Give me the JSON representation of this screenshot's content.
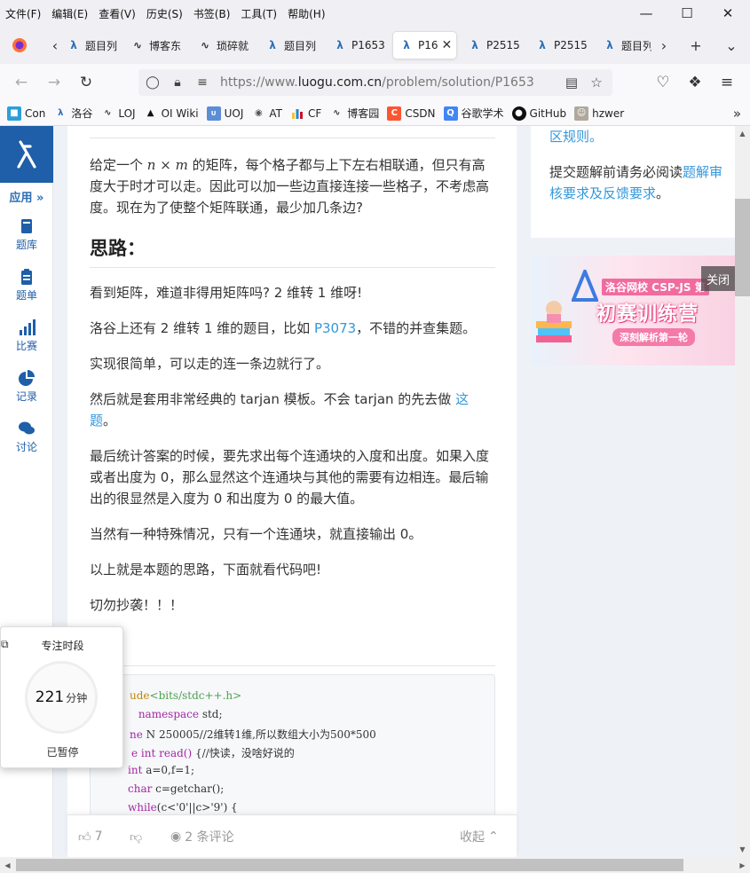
{
  "menu": [
    "文件(F)",
    "编辑(E)",
    "查看(V)",
    "历史(S)",
    "书签(B)",
    "工具(T)",
    "帮助(H)"
  ],
  "tabs": [
    {
      "label": "题目列",
      "icon": "luogu-icon"
    },
    {
      "label": "博客东",
      "icon": "cnblogs-icon"
    },
    {
      "label": "琐碎就",
      "icon": "cnblogs-icon"
    },
    {
      "label": "题目列",
      "icon": "luogu-icon"
    },
    {
      "label": "P1653",
      "icon": "luogu-icon"
    },
    {
      "label": "P16",
      "icon": "luogu-icon",
      "active": true
    },
    {
      "label": "P2515",
      "icon": "luogu-icon"
    },
    {
      "label": "P2515",
      "icon": "luogu-icon"
    },
    {
      "label": "题目列",
      "icon": "luogu-icon"
    }
  ],
  "url": {
    "prefix": "https://www.",
    "domain": "luogu.com.cn",
    "path": "/problem/solution/P1653"
  },
  "bookmarks": [
    {
      "label": "Con",
      "icon": "cube-icon",
      "color": "#2b6fb6"
    },
    {
      "label": "洛谷",
      "icon": "luogu-icon",
      "color": "#2b6fb6"
    },
    {
      "label": "LOJ",
      "icon": "loj-icon",
      "color": "#333333"
    },
    {
      "label": "OI Wiki",
      "icon": "graduation-cap-icon",
      "color": "#111111"
    },
    {
      "label": "UOJ",
      "icon": "uoj-icon",
      "color": "#e6a23c"
    },
    {
      "label": "AT",
      "icon": "atcoder-icon",
      "color": "#555555"
    },
    {
      "label": "CF",
      "icon": "codeforces-icon",
      "color": "#1f8acb"
    },
    {
      "label": "博客园",
      "icon": "cnblogs-icon",
      "color": "#333333"
    },
    {
      "label": "CSDN",
      "icon": "csdn-icon",
      "color": "#fc5531"
    },
    {
      "label": "谷歌学术",
      "icon": "scholar-icon",
      "color": "#4285f4"
    },
    {
      "label": "GitHub",
      "icon": "github-icon",
      "color": "#111111"
    },
    {
      "label": "hzwer",
      "icon": "avatar-icon",
      "color": "#888888"
    }
  ],
  "sidebar": {
    "apps": "应用 »",
    "items": [
      {
        "label": "题库",
        "icon": "book-icon"
      },
      {
        "label": "题单",
        "icon": "clipboard-icon"
      },
      {
        "label": "比赛",
        "icon": "bar-chart-icon"
      },
      {
        "label": "记录",
        "icon": "pie-chart-icon"
      },
      {
        "label": "讨论",
        "icon": "comments-icon"
      }
    ]
  },
  "article": {
    "problem_text_a": "给定一个 ",
    "problem_n": "n",
    "problem_times": " × ",
    "problem_m": "m",
    "problem_text_b": " 的矩阵，每个格子都与上下左右相联通，但只有高度大于时才可以走。因此可以加一些边直接连接一些格子，不考虑高度。现在为了使整个矩阵联通，最少加几条边?",
    "heading_idea": "思路：",
    "p1": "看到矩阵，难道非得用矩阵吗? 2 维转 1 维呀!",
    "p2_before": "洛谷上还有 2 维转 1 维的题目，比如 ",
    "p2_link": "P3073",
    "p2_after": "，不错的并查集题。",
    "p3": "实现很简单，可以走的连一条边就行了。",
    "p4_before": "然后就是套用非常经典的 tarjan 模板。不会 tarjan 的先去做 ",
    "p4_link": "这题",
    "p4_after": "。",
    "p5": "最后统计答案的时候，要先求出每个连通块的入度和出度。如果入度或者出度为 0，那么显然这个连通块与其他的需要有边相连。最后输出的很显然是入度为 0 和出度为 0 的最大值。",
    "p6": "当然有一种特殊情况，只有一个连通块，就直接输出 0。",
    "p7": "以上就是本题的思路，下面就看代码吧!",
    "p8": "切勿抄袭！！！",
    "heading_code": "：",
    "code_lines": [
      {
        "a": "ude",
        "b": "<bits/stdc++.h>",
        "c": ""
      },
      {
        "a": " namespace",
        "b": " std;",
        "c": ""
      },
      {
        "a": "ne",
        "b": " N 250005",
        "c": "//2维转1维,所以数组大小为500*500"
      },
      {
        "a": "e int read()",
        "b": " {",
        "c": "//快读，没啥好说的"
      },
      {
        "a": "int",
        "b": " a=0,f=1;",
        "c": ""
      },
      {
        "a": "char",
        "b": " c=getchar();",
        "c": ""
      },
      {
        "a": "while",
        "b": "(c<'0'||c>'9') {",
        "c": ""
      }
    ]
  },
  "footer": {
    "likes": "7",
    "comments": "2 条评论",
    "collapse": "收起"
  },
  "right_card": {
    "line0": "区规则。",
    "text_before": "提交题解前请务必阅读",
    "link": "题解审核要求及反馈要求",
    "text_after": "。"
  },
  "ad": {
    "tag": "洛谷网校 CSP-JS 第",
    "title": "初赛训练营",
    "sub": "深刻解析第一轮",
    "close": "关闭"
  },
  "focus_widget": {
    "title": "专注时段",
    "value": "221",
    "unit": "分钟",
    "status": "已暂停"
  },
  "colors": {
    "luogu_blue": "#1f5ea8",
    "link": "#3498db",
    "page_bg": "#eef2f7"
  }
}
